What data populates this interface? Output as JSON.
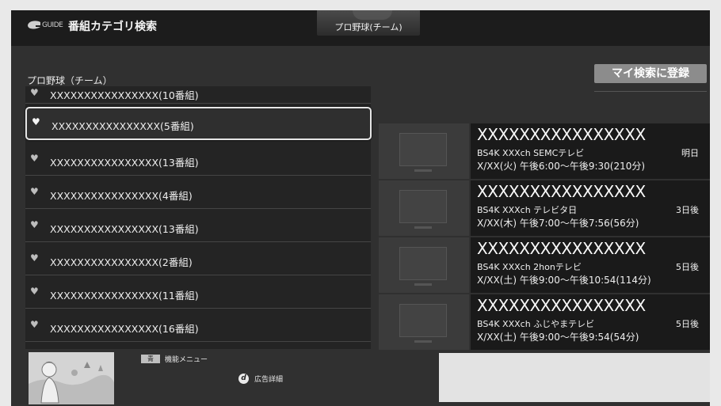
{
  "header": {
    "logo_text": "GUIDE",
    "title": "番組カテゴリ検索",
    "tab_label": "プロ野球(チーム)"
  },
  "category": {
    "title": "プロ野球（チーム）"
  },
  "register_button": {
    "label": "マイ検索に登録"
  },
  "team_list": [
    {
      "label": "XXXXXXXXXXXXXXXX(10番組)",
      "state": "partial"
    },
    {
      "label": "XXXXXXXXXXXXXXXX(5番組)",
      "state": "selected"
    },
    {
      "label": "XXXXXXXXXXXXXXXX(13番組)",
      "state": "normal"
    },
    {
      "label": "XXXXXXXXXXXXXXXX(4番組)",
      "state": "normal"
    },
    {
      "label": "XXXXXXXXXXXXXXXX(13番組)",
      "state": "normal"
    },
    {
      "label": "XXXXXXXXXXXXXXXX(2番組)",
      "state": "normal"
    },
    {
      "label": "XXXXXXXXXXXXXXXX(11番組)",
      "state": "normal"
    },
    {
      "label": "XXXXXXXXXXXXXXXX(16番組)",
      "state": "normal"
    }
  ],
  "programs": [
    {
      "title": "XXXXXXXXXXXXXXXX",
      "channel": "BS4K XXXch SEMCテレビ",
      "when": "明日",
      "time": "X/XX(火) 午後6:00〜午後9:30(210分)"
    },
    {
      "title": "XXXXXXXXXXXXXXXX",
      "channel": "BS4K XXXch テレビタ日",
      "when": "3日後",
      "time": "X/XX(木) 午後7:00〜午後7:56(56分)"
    },
    {
      "title": "XXXXXXXXXXXXXXXX",
      "channel": "BS4K XXXch 2honテレビ",
      "when": "5日後",
      "time": "X/XX(土) 午後9:00〜午後10:54(114分)"
    },
    {
      "title": "XXXXXXXXXXXXXXXX",
      "channel": "BS4K XXXch ふじやまテレビ",
      "when": "5日後",
      "time": "X/XX(土) 午後9:00〜午後9:54(54分)"
    }
  ],
  "footer": {
    "func_key": "青",
    "func_label": "機能メニュー",
    "ad_key": "d",
    "ad_label": "広告詳細"
  },
  "icons": {
    "list_item": "heart-icon",
    "program_thumb": "tv-icon",
    "logo": "guide-logo-icon"
  },
  "colors": {
    "background": "#303030",
    "header": "#1c1c1c",
    "register_button": "#8c8c8c",
    "selected_border": "#e6e6e6"
  }
}
